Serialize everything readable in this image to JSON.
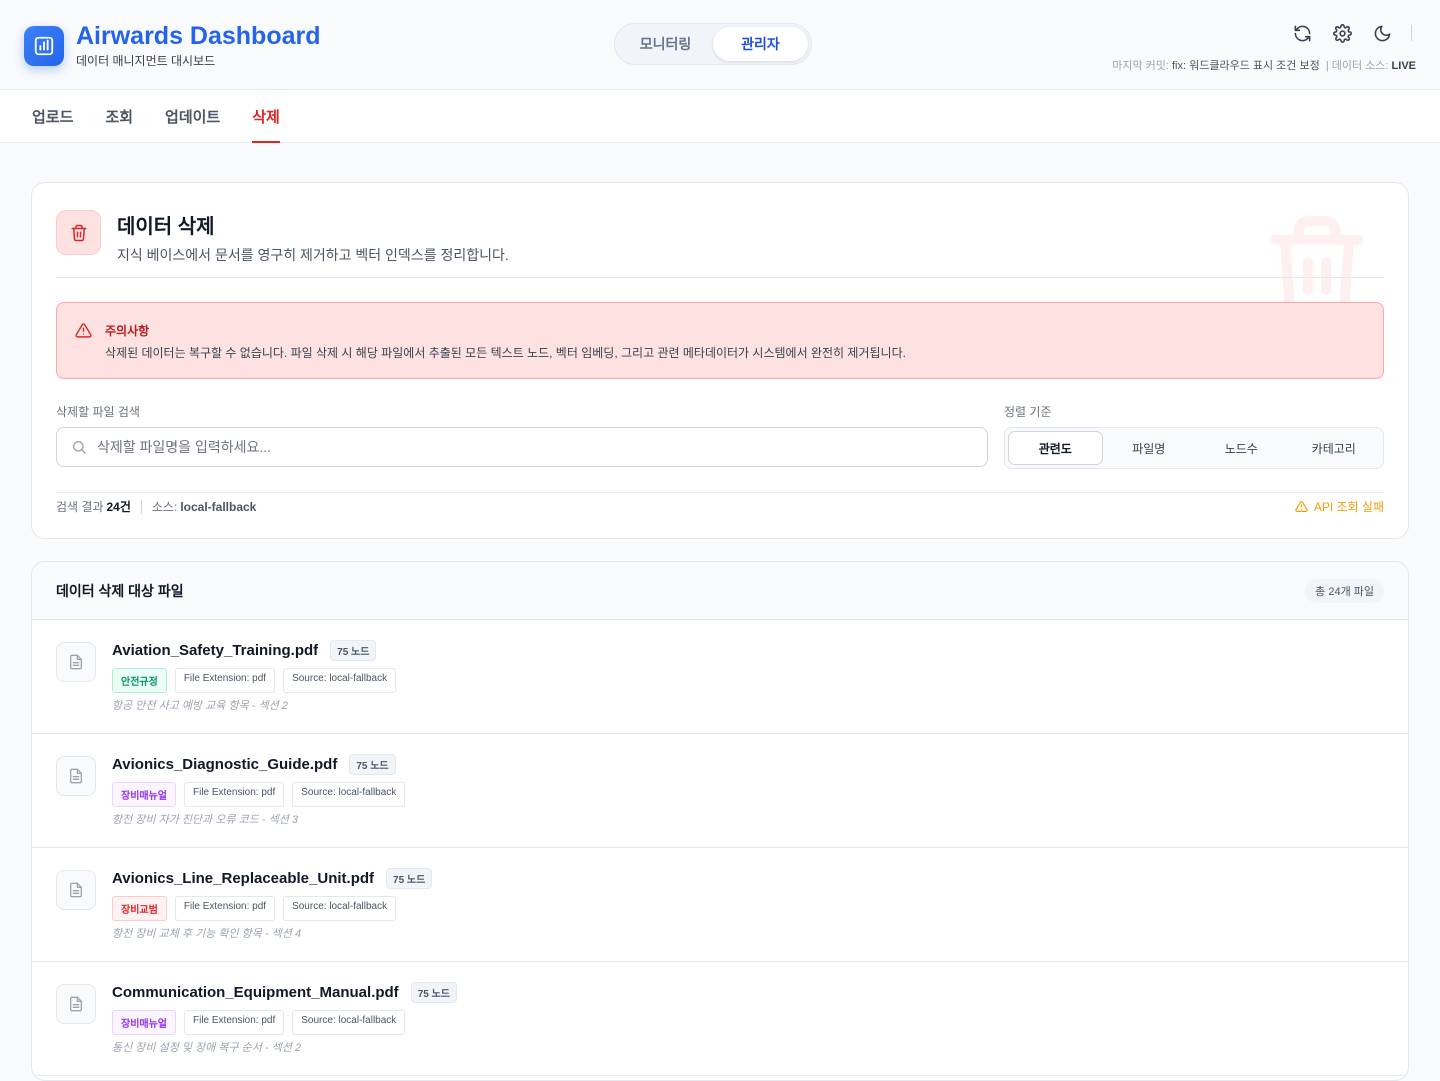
{
  "brand": {
    "title": "Airwards Dashboard",
    "subtitle": "데이터 매니지먼트 대시보드"
  },
  "mode_switch": {
    "monitoring": "모니터링",
    "admin": "관리자",
    "active": "admin"
  },
  "header_meta": {
    "commit_label": "마지막 커밋:",
    "commit_value": "fix: 워드클라우드 표시 조건 보정",
    "source_label": "| 데이터 소스:",
    "source_value": "LIVE"
  },
  "tabs": [
    {
      "label": "업로드",
      "active": false
    },
    {
      "label": "조회",
      "active": false
    },
    {
      "label": "업데이트",
      "active": false
    },
    {
      "label": "삭제",
      "active": true
    }
  ],
  "delete_panel": {
    "title": "데이터 삭제",
    "description": "지식 베이스에서 문서를 영구히 제거하고 벡터 인덱스를 정리합니다.",
    "warning_title": "주의사항",
    "warning_text": "삭제된 데이터는 복구할 수 없습니다. 파일 삭제 시 해당 파일에서 추출된 모든 텍스트 노드, 벡터 임베딩, 그리고 관련 메타데이터가 시스템에서 완전히 제거됩니다.",
    "search_label": "삭제할 파일 검색",
    "search_placeholder": "삭제할 파일명을 입력하세요...",
    "sort_label": "정렬 기준",
    "sort_options": [
      "관련도",
      "파일명",
      "노드수",
      "카테고리"
    ],
    "sort_selected": "관련도",
    "result_label": "검색 결과",
    "result_count": "24건",
    "source_label": "소스:",
    "source_value": "local-fallback",
    "api_fail": "API 조회 실패"
  },
  "file_list": {
    "title": "데이터 삭제 대상 파일",
    "total": "총 24개 파일",
    "files": [
      {
        "name": "Aviation_Safety_Training.pdf",
        "nodes": "75 노드",
        "category": "안전규정",
        "cat_color": "#059669",
        "cat_bg": "#ecfdf5",
        "cat_border": "#a7f3d0",
        "extension": "File Extension: pdf",
        "source": "Source: local-fallback",
        "desc": "항공 안전 사고 예방 교육 항목 - 섹션 2"
      },
      {
        "name": "Avionics_Diagnostic_Guide.pdf",
        "nodes": "75 노드",
        "category": "장비매뉴얼",
        "cat_color": "#9333ea",
        "cat_bg": "#faf5ff",
        "cat_border": "#e9d5ff",
        "extension": "File Extension: pdf",
        "source": "Source: local-fallback",
        "desc": "항전 장비 자가 진단과 오류 코드 - 섹션 3"
      },
      {
        "name": "Avionics_Line_Replaceable_Unit.pdf",
        "nodes": "75 노드",
        "category": "장비교범",
        "cat_color": "#dc2626",
        "cat_bg": "#fef2f2",
        "cat_border": "#fecaca",
        "extension": "File Extension: pdf",
        "source": "Source: local-fallback",
        "desc": "항전 장비 교체 후 기능 확인 항목 - 섹션 4"
      },
      {
        "name": "Communication_Equipment_Manual.pdf",
        "nodes": "75 노드",
        "category": "장비매뉴얼",
        "cat_color": "#9333ea",
        "cat_bg": "#faf5ff",
        "cat_border": "#e9d5ff",
        "extension": "File Extension: pdf",
        "source": "Source: local-fallback",
        "desc": "통신 장비 설정 및 장애 복구 순서 - 섹션 2"
      }
    ]
  }
}
